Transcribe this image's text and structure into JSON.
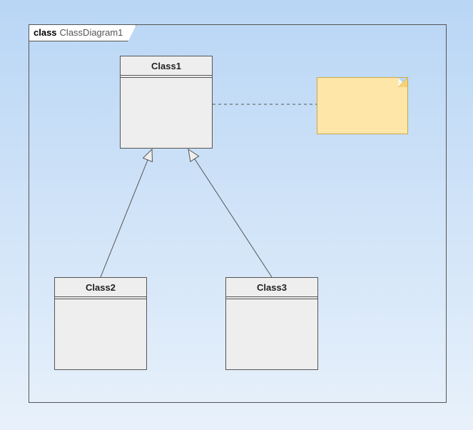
{
  "frame": {
    "keyword": "class",
    "name": "ClassDiagram1"
  },
  "classes": {
    "class1": {
      "name": "Class1"
    },
    "class2": {
      "name": "Class2"
    },
    "class3": {
      "name": "Class3"
    }
  },
  "relations": [
    {
      "type": "generalization",
      "from": "Class2",
      "to": "Class1"
    },
    {
      "type": "generalization",
      "from": "Class3",
      "to": "Class1"
    },
    {
      "type": "note-link",
      "from": "Class1",
      "to": "note1"
    }
  ],
  "notes": {
    "note1": {
      "text": ""
    }
  }
}
